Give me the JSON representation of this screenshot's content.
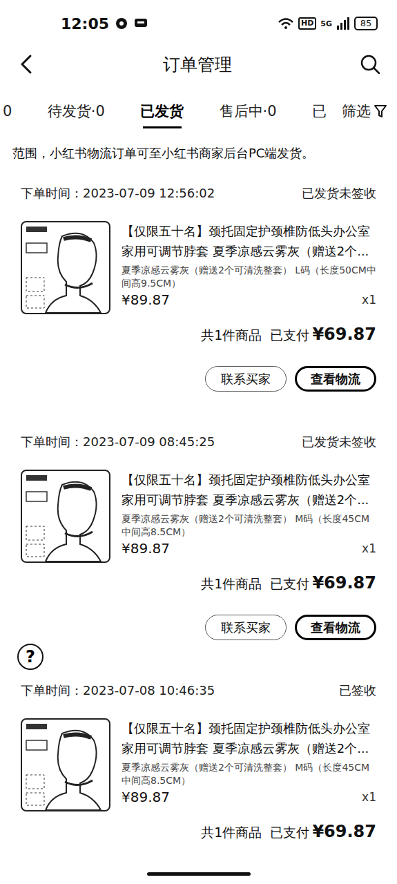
{
  "status_bar": {
    "time": "12:05",
    "hd": "HD",
    "network": "5G",
    "battery": "85"
  },
  "header": {
    "title": "订单管理"
  },
  "tabs": [
    {
      "label": "0",
      "selected": false
    },
    {
      "label": "待发货·0",
      "selected": false
    },
    {
      "label": "已发货",
      "selected": true
    },
    {
      "label": "售后中·0",
      "selected": false
    },
    {
      "label": "已",
      "selected": false
    }
  ],
  "filter": {
    "label": "筛选"
  },
  "notice": "范围，小红书物流订单可至小红书商家后台PC端发货。",
  "orders": [
    {
      "order_time": "下单时间：2023-07-09 12:56:02",
      "status": "已发货未签收",
      "title": "【仅限五十名】颈托固定护颈椎防低头办公室家用可调节脖套 夏季凉感云雾灰（赠送2个...",
      "spec": "夏季凉感云雾灰（赠送2个可清洗整套） L码（长度50CM中间高9.5CM）",
      "price": "¥89.87",
      "quantity": "x1",
      "count_text": "共1件商品",
      "paid_label": "已支付",
      "paid": "¥69.87",
      "buttons": [
        {
          "label": "联系买家",
          "primary": false
        },
        {
          "label": "查看物流",
          "primary": true
        }
      ]
    },
    {
      "order_time": "下单时间：2023-07-09 08:45:25",
      "status": "已发货未签收",
      "title": "【仅限五十名】颈托固定护颈椎防低头办公室家用可调节脖套 夏季凉感云雾灰（赠送2个...",
      "spec": "夏季凉感云雾灰（赠送2个可清洗整套） M码（长度45CM中间高8.5CM）",
      "price": "¥89.87",
      "quantity": "x1",
      "count_text": "共1件商品",
      "paid_label": "已支付",
      "paid": "¥69.87",
      "buttons": [
        {
          "label": "联系买家",
          "primary": false
        },
        {
          "label": "查看物流",
          "primary": true
        }
      ]
    },
    {
      "order_time": "下单时间：2023-07-08 10:46:35",
      "status": "已签收",
      "title": "【仅限五十名】颈托固定护颈椎防低头办公室家用可调节脖套 夏季凉感云雾灰（赠送2个...",
      "spec": "夏季凉感云雾灰（赠送2个可清洗整套） M码（长度45CM中间高8.5CM）",
      "price": "¥89.87",
      "quantity": "x1",
      "count_text": "共1件商品",
      "paid_label": "已支付",
      "paid": "¥69.87",
      "buttons": []
    }
  ],
  "help": "?"
}
